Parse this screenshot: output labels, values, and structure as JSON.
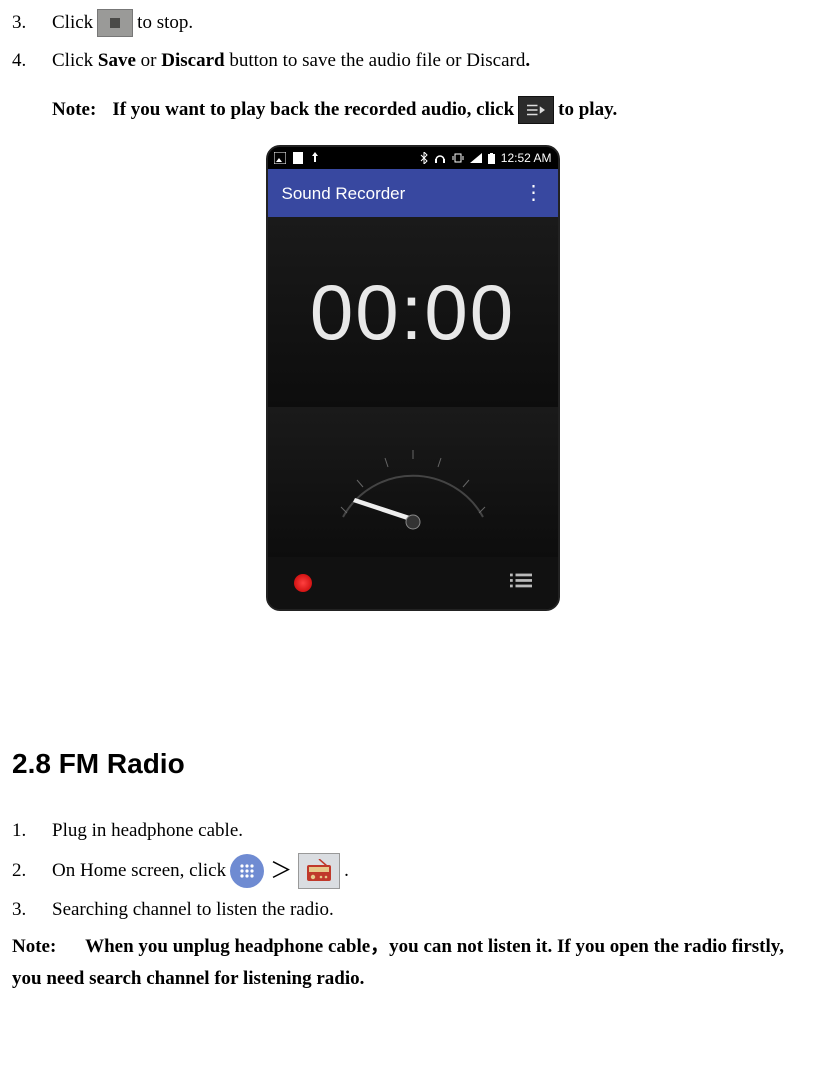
{
  "step3": {
    "num": "3.",
    "pre": "Click",
    "post": "to stop."
  },
  "step4": {
    "num": "4.",
    "pre": "Click ",
    "b1": "Save",
    "mid1": " or ",
    "b2": "Discard",
    "post": " button to save the audio file or Discard",
    "dot": "."
  },
  "note1": {
    "label": "Note:",
    "pre": "If you want to play back the recorded audio, click",
    "post": "to play."
  },
  "phone": {
    "status_time": "12:52 AM",
    "app_title": "Sound Recorder",
    "timer": "00:00"
  },
  "heading": "2.8 FM Radio",
  "fm_step1": {
    "num": "1.",
    "text": "Plug in headphone cable."
  },
  "fm_step2": {
    "num": "2.",
    "pre": "On Home screen, click",
    "gt": "＞",
    "dot": "."
  },
  "fm_step3": {
    "num": "3.",
    "text": "Searching channel to listen the radio."
  },
  "note2": {
    "label": "Note:",
    "text": "When you unplug headphone cable，you can not listen it. If you open the radio firstly, you need search channel for listening radio."
  }
}
